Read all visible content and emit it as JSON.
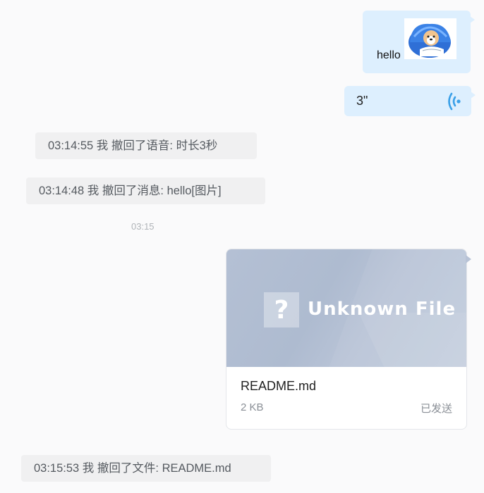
{
  "messages": {
    "image_message": {
      "text": "hello",
      "sticker_icon": "sleeping-dog-sticker"
    },
    "voice_message": {
      "duration": "3\"",
      "icon": "voice-wave-icon"
    },
    "file_message": {
      "preview_label": "Unknown File",
      "preview_icon": "?",
      "file_name": "README.md",
      "file_size": "2 KB",
      "status": "已发送"
    }
  },
  "notices": [
    {
      "time": "03:14:55",
      "text": "03:14:55 我 撤回了语音: 时长3秒"
    },
    {
      "time": "03:14:48",
      "text": "03:14:48 我 撤回了消息: hello[图片]"
    },
    {
      "time": "03:15:53",
      "text": "03:15:53 我 撤回了文件: README.md"
    }
  ],
  "time_divider": "03:15",
  "colors": {
    "bubble_out": "#ddeffe",
    "voice_icon": "#3aa0e8",
    "notice_bg": "#f0f0f1",
    "file_preview": "#b4c0d4"
  }
}
